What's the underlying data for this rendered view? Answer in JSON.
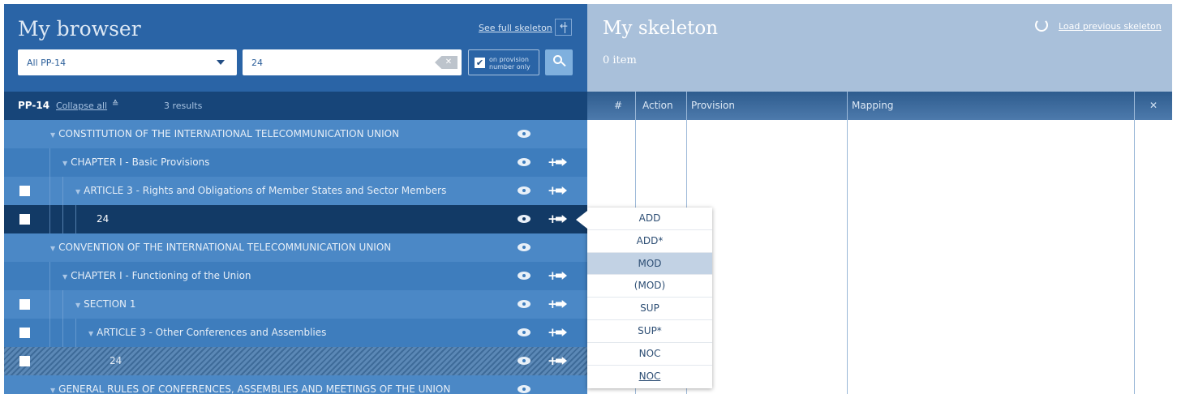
{
  "browser": {
    "title": "My browser",
    "full_skeleton_link": "See full skeleton",
    "filter_select": {
      "value": "All PP-14"
    },
    "search": {
      "value": "24",
      "clear_label": "✕"
    },
    "provision_toggle": {
      "checked_mark": "✔",
      "label": "on provision number only"
    },
    "subbar": {
      "name": "PP-14",
      "collapse": "Collapse all",
      "collapse_icon": "≙",
      "results": "3 results"
    },
    "rows": [
      {
        "label": "CONSTITUTION OF THE INTERNATIONAL TELECOMMUNICATION UNION"
      },
      {
        "label": "CHAPTER I - Basic Provisions"
      },
      {
        "label": "ARTICLE 3 - Rights and Obligations of Member States and Sector Members"
      },
      {
        "label": "24"
      },
      {
        "label": "CONVENTION OF THE INTERNATIONAL TELECOMMUNICATION UNION"
      },
      {
        "label": "CHAPTER I - Functioning of the Union"
      },
      {
        "label": "SECTION 1"
      },
      {
        "label": "ARTICLE 3 - Other Conferences and Assemblies"
      },
      {
        "label": "24"
      },
      {
        "label": "GENERAL RULES OF CONFERENCES, ASSEMBLIES AND MEETINGS OF THE UNION"
      }
    ],
    "triangle": "▼"
  },
  "skeleton": {
    "title": "My skeleton",
    "count": "0 item",
    "load_previous": "Load previous skeleton",
    "columns": {
      "num": "#",
      "action": "Action",
      "provision": "Provision",
      "mapping": "Mapping",
      "close": "✕"
    }
  },
  "action_menu": {
    "options": [
      "ADD",
      "ADD*",
      "MOD",
      "(MOD)",
      "SUP",
      "SUP*",
      "NOC",
      "NOC"
    ],
    "highlighted": "MOD"
  }
}
